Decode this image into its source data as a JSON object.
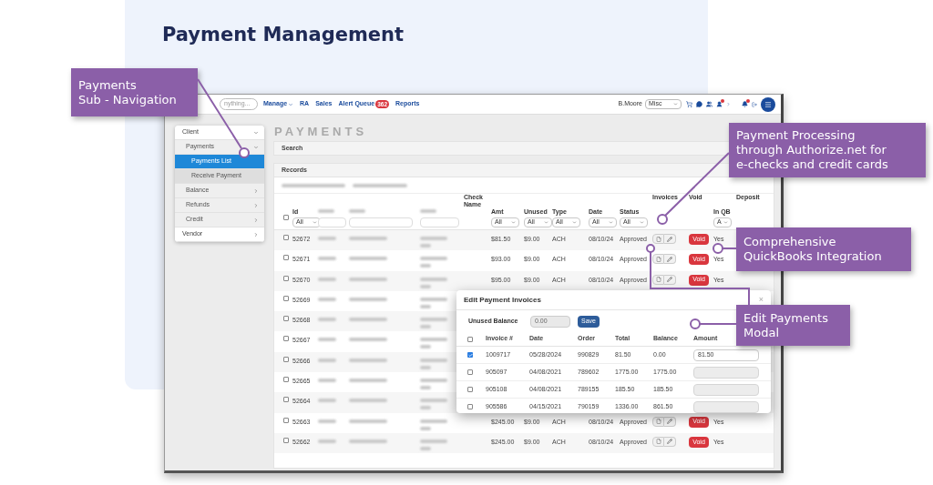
{
  "page_title": "Payment Management",
  "app": {
    "nav": {
      "search_placeholder": "nything...",
      "menu": [
        {
          "label": "Manage",
          "dropdown": true
        },
        {
          "label": "RA",
          "dropdown": false
        },
        {
          "label": "Sales",
          "dropdown": false
        },
        {
          "label": "Alert Queue",
          "dropdown": false,
          "badge": "362"
        },
        {
          "label": "Reports",
          "dropdown": false
        }
      ],
      "user": "B.Moore",
      "location": "Misc"
    },
    "sidebar": [
      {
        "label": "Client",
        "expanded": true,
        "selected": false,
        "children": [
          {
            "label": "Payments",
            "expanded": true,
            "selected": false,
            "children": [
              {
                "label": "Payments List",
                "selected": true
              },
              {
                "label": "Receive Payment",
                "selected": false
              }
            ]
          },
          {
            "label": "Balance",
            "expanded": false,
            "selected": false
          },
          {
            "label": "Refunds",
            "expanded": false,
            "selected": false
          },
          {
            "label": "Credit",
            "expanded": false,
            "selected": false
          }
        ]
      },
      {
        "label": "Vendor",
        "expanded": false,
        "selected": false
      }
    ],
    "heading": "PAYMENTS",
    "sections": [
      "Search",
      "Records"
    ],
    "table": {
      "all_checked": false,
      "columns": [
        {
          "kind": "checkbox"
        },
        {
          "kind": "text",
          "label": "Id",
          "filter": "All"
        },
        {
          "kind": "blurred"
        },
        {
          "kind": "blurred"
        },
        {
          "kind": "blurred"
        },
        {
          "kind": "text",
          "label": "Check Name"
        },
        {
          "kind": "text",
          "label": "Amt",
          "filter": "All"
        },
        {
          "kind": "text",
          "label": "Unused",
          "filter": "All"
        },
        {
          "kind": "text",
          "label": "Type",
          "filter": "All"
        },
        {
          "kind": "text",
          "label": "Date",
          "filter": "All"
        },
        {
          "kind": "text",
          "label": "Status",
          "filter": "All"
        },
        {
          "kind": "text",
          "label": "Invoices"
        },
        {
          "kind": "text",
          "label": "Void"
        },
        {
          "kind": "text",
          "label": "In QB",
          "filter": "A"
        },
        {
          "kind": "text",
          "label": "Deposit"
        }
      ],
      "rows": [
        {
          "checked": false,
          "id": "52672",
          "amt": "$81.50",
          "unused": "$9.00",
          "type": "ACH",
          "date": "08/10/24",
          "status": "Approved",
          "void": "Void",
          "in_qb": "Yes"
        },
        {
          "checked": false,
          "id": "52671",
          "amt": "$93.00",
          "unused": "$9.00",
          "type": "ACH",
          "date": "08/10/24",
          "status": "Approved",
          "void": "Void",
          "in_qb": "Yes"
        },
        {
          "checked": false,
          "id": "52670",
          "amt": "$95.00",
          "unused": "$9.00",
          "type": "ACH",
          "date": "08/10/24",
          "status": "Approved",
          "void": "Void",
          "in_qb": "Yes"
        },
        {
          "checked": false,
          "id": "52669"
        },
        {
          "checked": false,
          "id": "52668"
        },
        {
          "checked": false,
          "id": "52667"
        },
        {
          "checked": false,
          "id": "52666"
        },
        {
          "checked": false,
          "id": "52665"
        },
        {
          "checked": false,
          "id": "52664"
        },
        {
          "checked": false,
          "id": "52663",
          "amt": "$245.00",
          "unused": "$9.00",
          "type": "ACH",
          "date": "08/10/24",
          "status": "Approved",
          "void": "Void",
          "in_qb": "Yes"
        },
        {
          "checked": false,
          "id": "52662",
          "amt": "$245.00",
          "unused": "$9.00",
          "type": "ACH",
          "date": "08/10/24",
          "status": "Approved",
          "void": "Void",
          "in_qb": "Yes"
        }
      ]
    },
    "modal": {
      "all_checked": false,
      "title": "Edit Payment Invoices",
      "close": "×",
      "unused_label": "Unused Balance",
      "unused_value": "0.00",
      "save": "Save",
      "columns": [
        "Invoice #",
        "Date",
        "Order",
        "Total",
        "Balance",
        "Amount"
      ],
      "rows": [
        {
          "checked": true,
          "invoice": "1009717",
          "date": "05/28/2024",
          "order": "990829",
          "total": "81.50",
          "balance": "0.00",
          "amount": "81.50"
        },
        {
          "checked": false,
          "invoice": "905097",
          "date": "04/08/2021",
          "order": "789602",
          "total": "1775.00",
          "balance": "1775.00"
        },
        {
          "checked": false,
          "invoice": "905108",
          "date": "04/08/2021",
          "order": "789155",
          "total": "185.50",
          "balance": "185.50"
        },
        {
          "checked": false,
          "invoice": "905586",
          "date": "04/15/2021",
          "order": "790159",
          "total": "1336.00",
          "balance": "861.50"
        }
      ]
    }
  },
  "callouts": [
    {
      "lines": [
        "Payments",
        "Sub - Navigation"
      ]
    },
    {
      "lines": [
        "Payment Processing",
        "through Authorize.net for",
        "e-checks and credit cards"
      ]
    },
    {
      "lines": [
        "Comprehensive",
        "QuickBooks Integration"
      ]
    },
    {
      "lines": [
        "Edit Payments",
        "Modal"
      ]
    }
  ]
}
